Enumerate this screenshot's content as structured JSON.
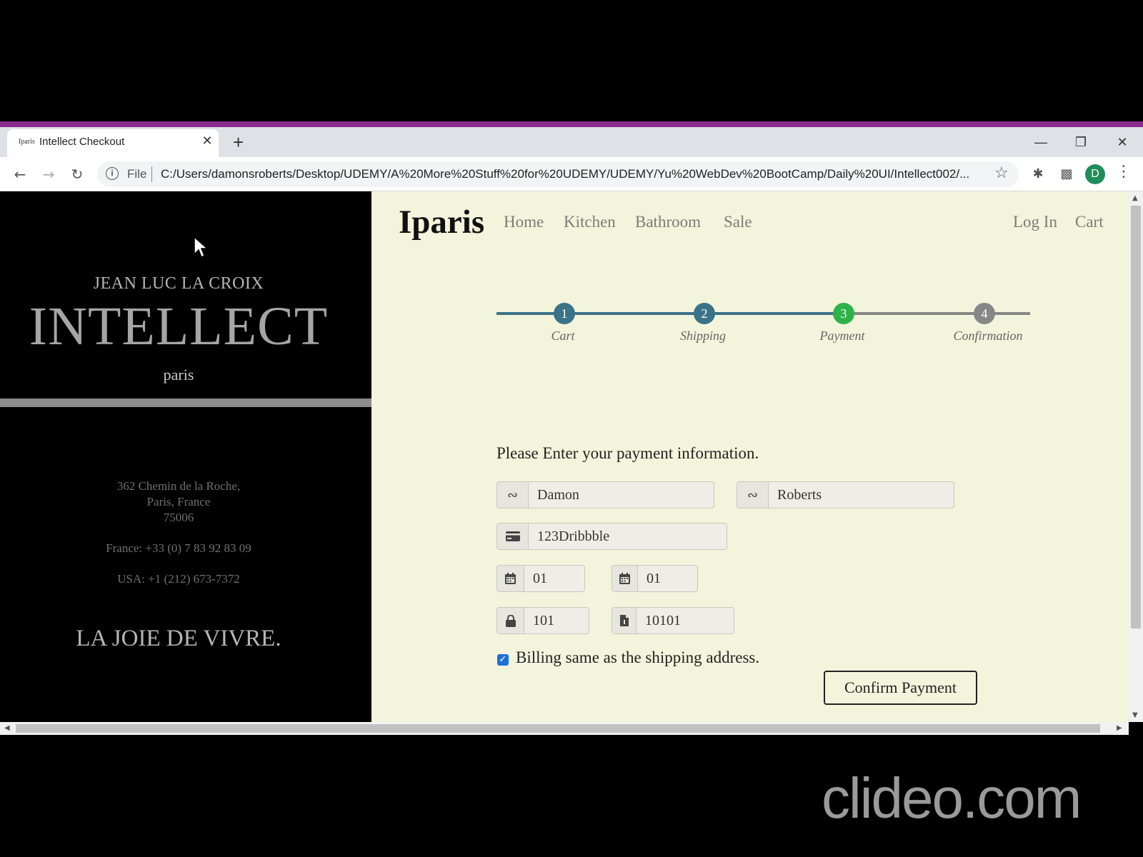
{
  "browser": {
    "tab_favicon": "Iparis",
    "tab_title": "Intellect Checkout",
    "tab_close": "✕",
    "new_tab": "+",
    "url_scheme": "File",
    "url": "C:/Users/damonsroberts/Desktop/UDEMY/A%20More%20Stuff%20for%20UDEMY/UDEMY/Yu%20WebDev%20BootCamp/Daily%20UI/Intellect002/...",
    "avatar_initial": "D",
    "accent_color": "#8a2a8e"
  },
  "left": {
    "kicker": "JEAN LUC LA CROIX",
    "brand": "INTELLECT",
    "city": "paris",
    "address_line1": "362 Chemin de la Roche,",
    "address_line2": "Paris, France",
    "address_line3": "75006",
    "phone_fr": "France: +33 (0) 7 83 92 83 09",
    "phone_us": "USA: +1 (212) 673-7372",
    "motto": "LA JOIE DE VIVRE."
  },
  "nav": {
    "logo": "Iparis",
    "links": [
      "Home",
      "Kitchen",
      "Bathroom",
      "Sale"
    ],
    "login": "Log In",
    "cart": "Cart"
  },
  "progress": {
    "steps": [
      {
        "number": "1",
        "label": "Cart",
        "state": "done"
      },
      {
        "number": "2",
        "label": "Shipping",
        "state": "done"
      },
      {
        "number": "3",
        "label": "Payment",
        "state": "active"
      },
      {
        "number": "4",
        "label": "Confirmation",
        "state": "pending"
      }
    ],
    "done_color": "#3a7287",
    "active_color": "#2fb24a",
    "pending_color": "#878787"
  },
  "form": {
    "prompt": "Please Enter your payment information.",
    "first_name": "Damon",
    "last_name": "Roberts",
    "card_number": "123Dribbble",
    "exp_month": "01",
    "exp_year": "01",
    "cvv": "101",
    "zip": "10101",
    "billing_same_label": "Billing same as the shipping address.",
    "billing_same_checked": true,
    "confirm_label": "Confirm Payment"
  },
  "watermark": "clideo.com"
}
